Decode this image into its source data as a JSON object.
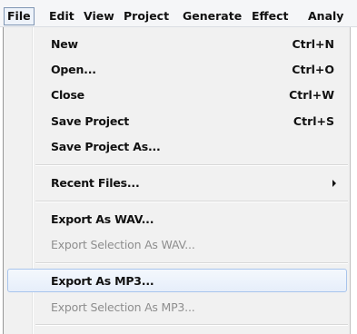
{
  "menubar": {
    "items": [
      "File",
      "Edit",
      "View",
      "Project",
      "Generate",
      "Effect",
      "Analy"
    ]
  },
  "file_menu": {
    "items": [
      {
        "label": "New",
        "shortcut": "Ctrl+N"
      },
      {
        "label": "Open...",
        "shortcut": "Ctrl+O"
      },
      {
        "label": "Close",
        "shortcut": "Ctrl+W"
      },
      {
        "label": "Save Project",
        "shortcut": "Ctrl+S"
      },
      {
        "label": "Save Project As..."
      },
      {
        "label": "Recent Files...",
        "submenu_indicator": "arrow-right"
      },
      {
        "label": "Export As WAV..."
      },
      {
        "label": "Export Selection As WAV...",
        "state": "disabled"
      },
      {
        "label": "Export As MP3...",
        "state": "highlighted"
      },
      {
        "label": "Export Selection As MP3...",
        "state": "disabled"
      }
    ]
  },
  "colors": {
    "highlight_border": "#a8c4ec",
    "disabled_text": "#8e8e8e",
    "menu_background": "#f1f1f1"
  }
}
